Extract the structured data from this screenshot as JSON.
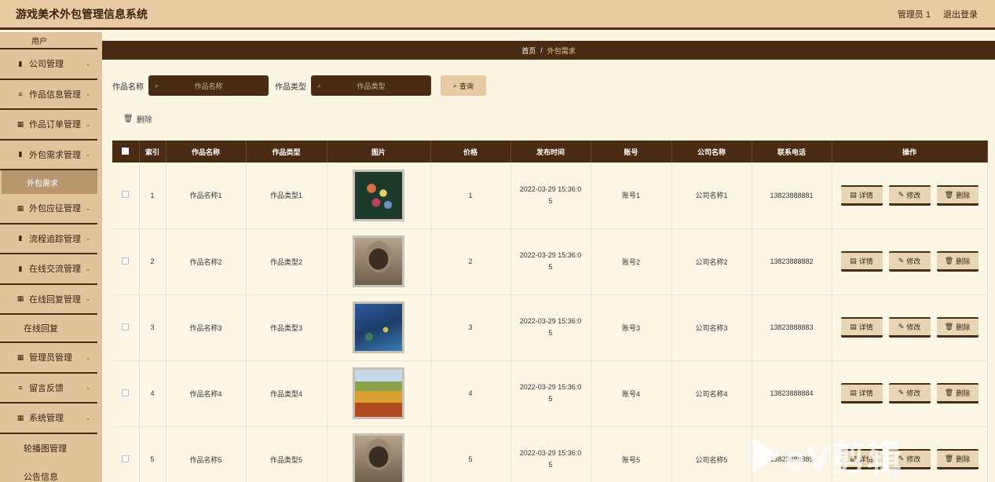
{
  "app": {
    "title": "游戏美术外包管理信息系统",
    "user": "管理员 1",
    "logout": "退出登录"
  },
  "sidebar": {
    "top_item": "用户",
    "items": [
      {
        "label": "公司管理",
        "icon": "▮"
      },
      {
        "label": "作品信息管理",
        "icon": "≡"
      },
      {
        "label": "作品订单管理",
        "icon": "▦"
      },
      {
        "label": "外包需求管理",
        "icon": "▮"
      },
      {
        "label": "外包应征管理",
        "icon": "▦"
      },
      {
        "label": "流程追踪管理",
        "icon": "▮"
      },
      {
        "label": "在线交流管理",
        "icon": "▮"
      },
      {
        "label": "在线回复管理",
        "icon": "▦"
      },
      {
        "label": "管理员管理",
        "icon": "▦"
      },
      {
        "label": "留言反馈",
        "icon": "≡"
      },
      {
        "label": "系统管理",
        "icon": "▦"
      }
    ],
    "active_sub": "外包需求",
    "sub_reply": "在线回复",
    "sub_carousel": "轮播图管理",
    "sub_notice": "公告信息"
  },
  "breadcrumb": {
    "home": "首页",
    "sep": "/",
    "current": "外包需求"
  },
  "search": {
    "name_label": "作品名称",
    "name_placeholder": "作品名称",
    "type_label": "作品类型",
    "type_placeholder": "作品类型",
    "button": "查询"
  },
  "actions": {
    "delete": "删除"
  },
  "table": {
    "headers": [
      "索引",
      "作品名称",
      "作品类型",
      "图片",
      "价格",
      "发布时间",
      "账号",
      "公司名称",
      "联系电话",
      "操作"
    ],
    "ops": {
      "detail": "详情",
      "edit": "修改",
      "delete": "删除"
    },
    "rows": [
      {
        "idx": "1",
        "name": "作品名称1",
        "type": "作品类型1",
        "price": "1",
        "time1": "2022-03-29 15:36:0",
        "time2": "5",
        "account": "账号1",
        "company": "公司名称1",
        "phone": "13823888881",
        "img": "flowers"
      },
      {
        "idx": "2",
        "name": "作品名称2",
        "type": "作品类型2",
        "price": "2",
        "time1": "2022-03-29 15:36:0",
        "time2": "5",
        "account": "账号2",
        "company": "公司名称2",
        "phone": "13823888882",
        "img": "portrait"
      },
      {
        "idx": "3",
        "name": "作品名称3",
        "type": "作品类型3",
        "price": "3",
        "time1": "2022-03-29 15:36:0",
        "time2": "5",
        "account": "账号3",
        "company": "公司名称3",
        "phone": "13823888883",
        "img": "lake"
      },
      {
        "idx": "4",
        "name": "作品名称4",
        "type": "作品类型4",
        "price": "4",
        "time1": "2022-03-29 15:36:0",
        "time2": "5",
        "account": "账号4",
        "company": "公司名称4",
        "phone": "13823888884",
        "img": "field"
      },
      {
        "idx": "5",
        "name": "作品名称5",
        "type": "作品类型5",
        "price": "5",
        "time1": "2022-03-29 15:36:0",
        "time2": "5",
        "account": "账号5",
        "company": "公司名称5",
        "phone": "13823888885",
        "img": "portrait"
      }
    ]
  },
  "colors": {
    "dark": "#4a2c14",
    "sand": "#e2c49c",
    "cream": "#fbf5e4"
  }
}
